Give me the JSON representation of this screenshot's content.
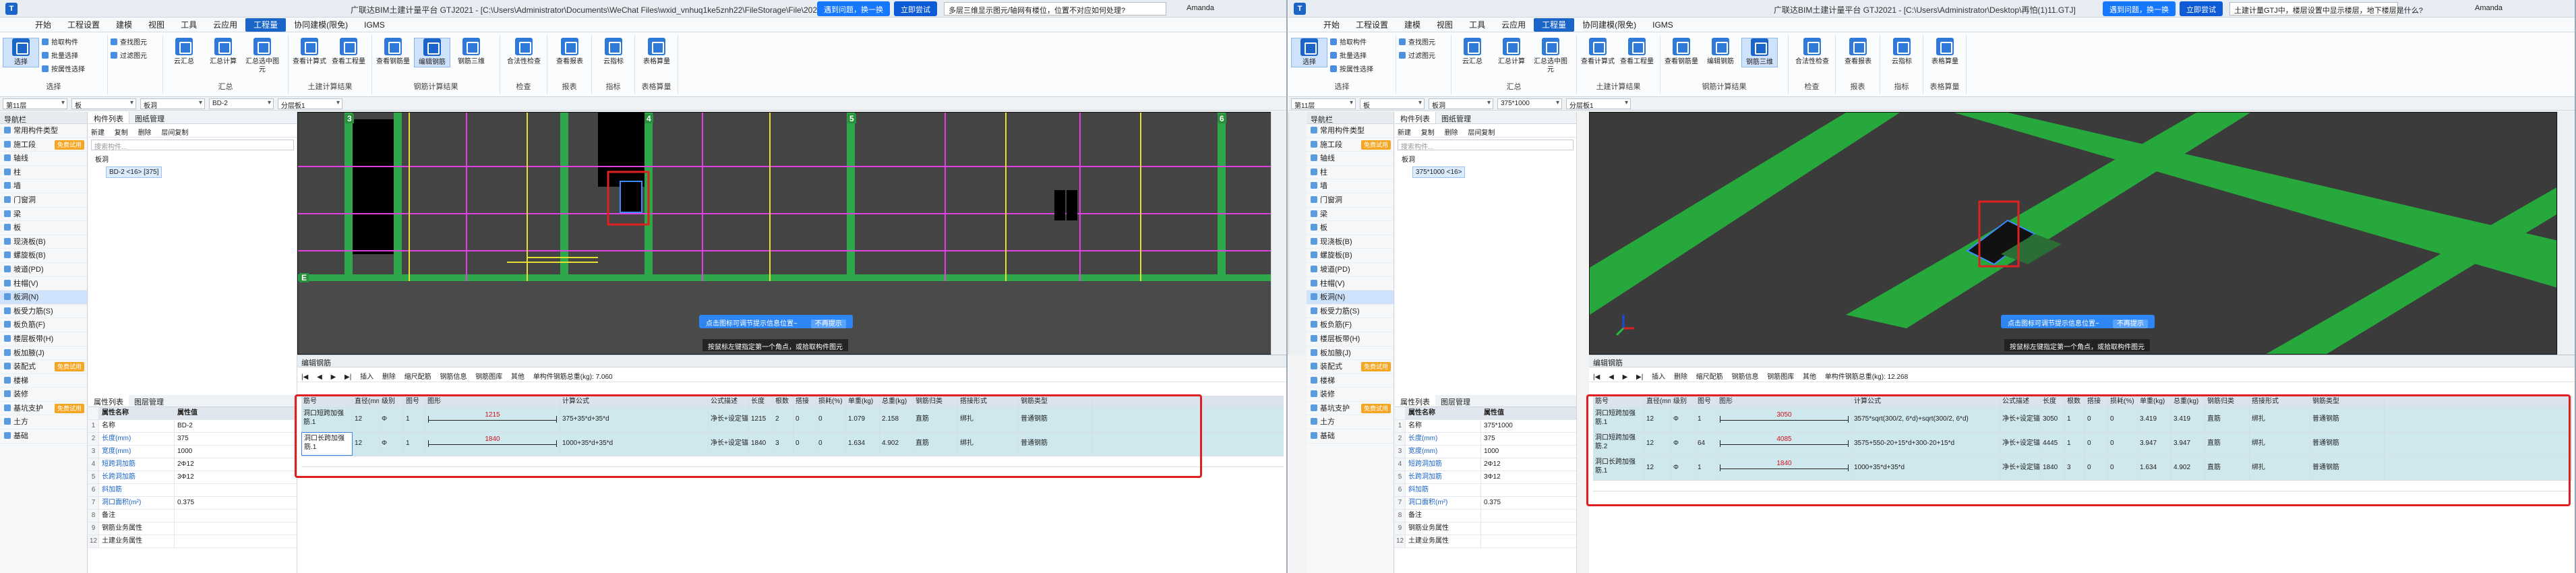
{
  "left": {
    "title": "广联达BIM土建计量平台 GTJ2021 - [C:\\Users\\Administrator\\Documents\\WeChat Files\\wxid_vnhuq1ke5znh22\\FileStorage\\File\\2024-01\\整体\\(1)\\GTJ]",
    "banner1": "遇到问题，换一换",
    "banner2": "立即尝试",
    "ask": "多层三维显示图元/轴网有楼位，位置不对应如何处理?",
    "user": "Amanda",
    "menus": [
      "开始",
      "工程设置",
      "建模",
      "视图",
      "工具",
      "云应用",
      "工程量",
      "协同建模(限免)",
      "IGMS"
    ],
    "active_menu": "工程量",
    "ribbon": {
      "select_label": "选择",
      "pick": "拾取构件",
      "batch": "批量选择",
      "by_prop": "按属性选择",
      "find": "查找图元",
      "filter": "过滤图元",
      "cloud_check": "云汇总",
      "summary_calc": "汇总计算",
      "summary_sel": "汇总选中图元",
      "view_calc": "查看计算式",
      "view_qty": "查看工程量",
      "view_rebar": "查看钢筋量",
      "edit_rebar": "编辑钢筋",
      "rebar3d": "钢筋三维",
      "lucky_check": "合法性检查",
      "report_view": "查看报表",
      "cloud_index": "云指标",
      "table_calc": "表格算量",
      "g_select": "选择",
      "g_summary": "汇总",
      "g_qty": "土建计算结果",
      "g_rebar": "钢筋计算结果",
      "g_check": "检查",
      "g_report": "报表",
      "g_index": "指标",
      "g_table": "表格算量"
    },
    "combos": [
      "第11层",
      "板",
      "板洞",
      "BD-2",
      "分层板1"
    ],
    "nav": {
      "header": "导航栏",
      "items": [
        "常用构件类型",
        "施工段",
        "轴线",
        "柱",
        "墙",
        "门窗洞",
        "梁",
        "板",
        "现浇板(B)",
        "螺旋板(B)",
        "坡道(PD)",
        "柱帽(V)",
        "板洞(N)",
        "板受力筋(S)",
        "板负筋(F)",
        "楼层板带(H)",
        "板加腋(J)",
        "装配式",
        "楼梯",
        "装修",
        "基坑支护",
        "土方",
        "基础"
      ],
      "selected": "板洞(N)",
      "badge": "免费试用"
    },
    "complist": {
      "tab1": "构件列表",
      "tab2": "图纸管理",
      "tools": [
        "新建",
        "复制",
        "删除",
        "层间复制"
      ],
      "search": "搜索构件...",
      "root": "板洞",
      "item": "BD-2 <16> [375]"
    },
    "props": {
      "tab1": "属性列表",
      "tab2": "图层管理",
      "h_name": "属性名称",
      "h_val": "属性值",
      "rows": [
        {
          "n": "1",
          "k": "名称",
          "v": "BD-2"
        },
        {
          "n": "2",
          "k": "长度(mm)",
          "v": "375"
        },
        {
          "n": "3",
          "k": "宽度(mm)",
          "v": "1000"
        },
        {
          "n": "4",
          "k": "短跨洞加筋",
          "v": "2Φ12"
        },
        {
          "n": "5",
          "k": "长跨洞加筋",
          "v": "3Φ12"
        },
        {
          "n": "6",
          "k": "斜加筋",
          "v": ""
        },
        {
          "n": "7",
          "k": "洞口面积(m²)",
          "v": "0.375"
        },
        {
          "n": "8",
          "k": "备注",
          "v": ""
        },
        {
          "n": "9",
          "k": "钢筋业务属性",
          "v": ""
        },
        {
          "n": "12",
          "k": "土建业务属性",
          "v": ""
        }
      ]
    },
    "viewport": {
      "grid_labels": [
        "3",
        "4",
        "5",
        "6",
        "E"
      ],
      "hint": "点击图标可调节提示信息位置~",
      "hint_btn": "不再提示",
      "bottom": "按鼠标左键指定第一个角点，或拾取构件图元"
    },
    "editor": {
      "title": "编辑钢筋",
      "tools": [
        "插入",
        "删除",
        "缩尺配筋",
        "钢筋信息",
        "钢筋图库",
        "其他",
        "单构件钢筋总重(kg): 7.060"
      ],
      "headers": [
        "筋号",
        "直径(mm)",
        "级别",
        "图号",
        "图形",
        "计算公式",
        "公式描述",
        "长度",
        "根数",
        "搭接",
        "损耗(%)",
        "单重(kg)",
        "总重(kg)",
        "钢筋归类",
        "搭接形式",
        "钢筋类型"
      ],
      "rows": [
        {
          "name": "洞口短跨加强筋.1",
          "dia": "12",
          "grade": "Φ",
          "fig": "1",
          "shape": "1215",
          "formula": "375+35*d+35*d",
          "desc": "净长+设定锚固+...",
          "len": "1215",
          "cnt": "2",
          "lap": "0",
          "loss": "0",
          "unit": "1.079",
          "total": "2.158",
          "cat": "直筋",
          "lapform": "绑扎",
          "type": "普通钢筋"
        },
        {
          "name": "洞口长跨加强筋.1",
          "dia": "12",
          "grade": "Φ",
          "fig": "1",
          "shape": "1840",
          "formula": "1000+35*d+35*d",
          "desc": "净长+设定锚固+...",
          "len": "1840",
          "cnt": "3",
          "lap": "0",
          "loss": "0",
          "unit": "1.634",
          "total": "4.902",
          "cat": "直筋",
          "lapform": "绑扎",
          "type": "普通钢筋"
        }
      ]
    }
  },
  "right": {
    "title": "广联达BIM土建计量平台 GTJ2021 - [C:\\Users\\Administrator\\Desktop\\再怕(1)11.GTJ]",
    "banner1": "遇到问题，换一换",
    "banner2": "立即尝试",
    "ask": "土建计量GTJ中，楼层设置中显示楼层，地下楼层是什么?",
    "user": "Amanda",
    "combos": [
      "第11层",
      "板",
      "板洞",
      "375*1000",
      "分层板1"
    ],
    "complist": {
      "root": "板洞",
      "item": "375*1000 <16>"
    },
    "props": {
      "rows": [
        {
          "n": "1",
          "k": "名称",
          "v": "375*1000"
        },
        {
          "n": "2",
          "k": "长度(mm)",
          "v": "375"
        },
        {
          "n": "3",
          "k": "宽度(mm)",
          "v": "1000"
        },
        {
          "n": "4",
          "k": "短跨洞加筋",
          "v": "2Φ12"
        },
        {
          "n": "5",
          "k": "长跨洞加筋",
          "v": "3Φ12"
        },
        {
          "n": "6",
          "k": "斜加筋",
          "v": ""
        },
        {
          "n": "7",
          "k": "洞口面积(m²)",
          "v": "0.375"
        },
        {
          "n": "8",
          "k": "备注",
          "v": ""
        },
        {
          "n": "9",
          "k": "钢筋业务属性",
          "v": ""
        },
        {
          "n": "12",
          "k": "土建业务属性",
          "v": ""
        }
      ]
    },
    "editor": {
      "tools": [
        "插入",
        "删除",
        "缩尺配筋",
        "钢筋信息",
        "钢筋图库",
        "其他",
        "单构件钢筋总重(kg): 12.268"
      ],
      "rows": [
        {
          "name": "洞口短跨加强筋.1",
          "dia": "12",
          "grade": "Φ",
          "fig": "1",
          "shape": "3050",
          "formula": "3575*sqrt(300/2, 6*d)+sqrt(300/2, 6*d)",
          "desc": "净长+设定锚固+...",
          "len": "3050",
          "cnt": "1",
          "lap": "0",
          "loss": "0",
          "unit": "3.419",
          "total": "3.419",
          "cat": "直筋",
          "lapform": "绑扎",
          "type": "普通钢筋"
        },
        {
          "name": "洞口短跨加强筋.2",
          "dia": "12",
          "grade": "Φ",
          "fig": "64",
          "shape": "4085",
          "formula": "3575+550-20+15*d+300-20+15*d",
          "desc": "净长+设定锚固+...",
          "len": "4445",
          "cnt": "1",
          "lap": "0",
          "loss": "0",
          "unit": "3.947",
          "total": "3.947",
          "cat": "直筋",
          "lapform": "绑扎",
          "type": "普通钢筋"
        },
        {
          "name": "洞口长跨加强筋.1",
          "dia": "12",
          "grade": "Φ",
          "fig": "1",
          "shape": "1840",
          "formula": "1000+35*d+35*d",
          "desc": "净长+设定锚固+...",
          "len": "1840",
          "cnt": "3",
          "lap": "0",
          "loss": "0",
          "unit": "1.634",
          "total": "4.902",
          "cat": "直筋",
          "lapform": "绑扎",
          "type": "普通钢筋"
        }
      ]
    }
  },
  "colors": {
    "accent": "#1b64c8",
    "highlight": "#e02020",
    "green": "#2ea84a",
    "magenta": "#e040e0",
    "yellow": "#e8e030"
  }
}
